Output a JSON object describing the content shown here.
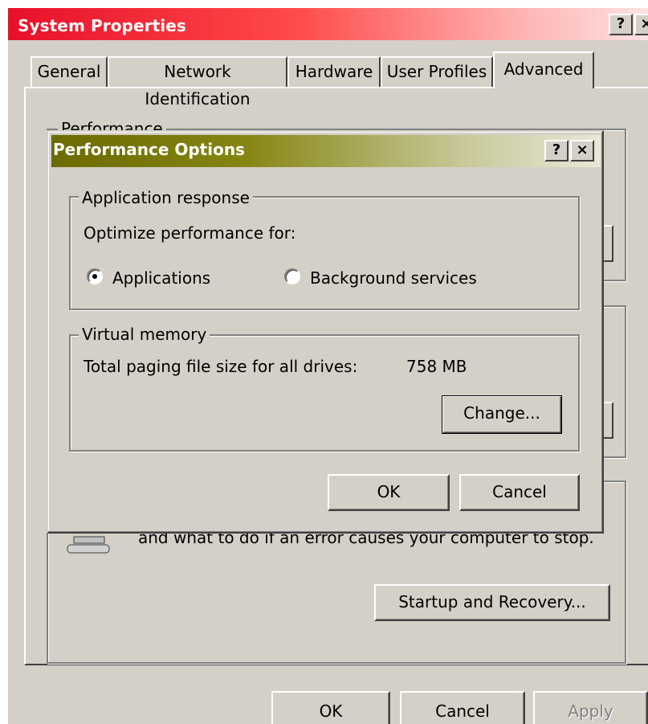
{
  "system_properties": {
    "title": "System Properties",
    "help_button": "?",
    "close_button": "×",
    "tabs": [
      {
        "label": "General"
      },
      {
        "label": "Network Identification"
      },
      {
        "label": "Hardware"
      },
      {
        "label": "User Profiles"
      },
      {
        "label": "Advanced",
        "active": true
      }
    ],
    "performance_group_label": "Performance",
    "startup_text": "and what to do if an error causes your computer to stop.",
    "startup_recovery_button": "Startup and Recovery...",
    "ok_button": "OK",
    "cancel_button": "Cancel",
    "apply_button": "Apply"
  },
  "performance_options": {
    "title": "Performance Options",
    "help_button": "?",
    "close_button": "×",
    "application_response": {
      "label": "Application response",
      "prompt": "Optimize performance for:",
      "options": [
        {
          "label": "Applications",
          "selected": true
        },
        {
          "label": "Background services",
          "selected": false
        }
      ]
    },
    "virtual_memory": {
      "label": "Virtual memory",
      "paging_label": "Total paging file size for all drives:",
      "paging_value": "758 MB",
      "change_button": "Change..."
    },
    "ok_button": "OK",
    "cancel_button": "Cancel"
  },
  "colors": {
    "face": "#d4d0c8",
    "sys_title_gradient_start": "#e8102a",
    "perf_title_gradient_start": "#6b6b00"
  }
}
